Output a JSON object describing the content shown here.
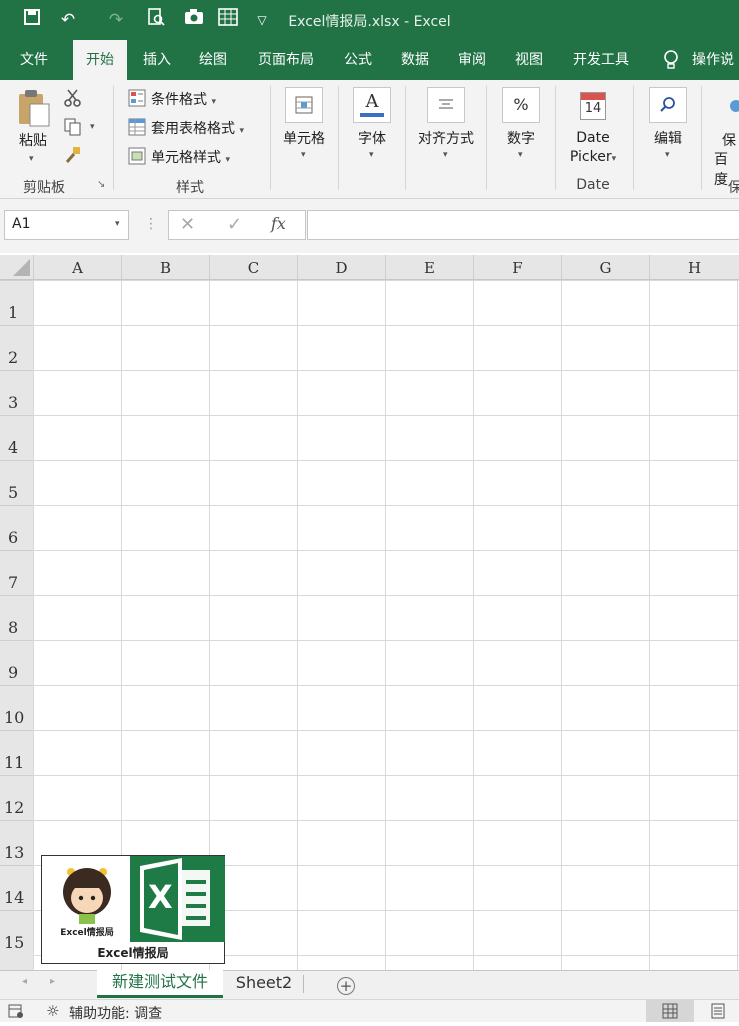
{
  "window": {
    "title": "Excel情报局.xlsx  -  Excel"
  },
  "ribbon_tabs": [
    "文件",
    "开始",
    "插入",
    "绘图",
    "页面布局",
    "公式",
    "数据",
    "审阅",
    "视图",
    "开发工具"
  ],
  "tell_me": "操作说",
  "clipboard": {
    "paste_label": "粘贴",
    "group_label": "剪贴板"
  },
  "styles": {
    "conditional": "条件格式",
    "table": "套用表格格式",
    "cell": "单元格样式",
    "group_label": "样式"
  },
  "cells_group": {
    "label": "单元格"
  },
  "font_group": {
    "label": "字体"
  },
  "align_group": {
    "label": "对齐方式"
  },
  "number_group": {
    "label": "数字",
    "glyph": "%"
  },
  "date_group": {
    "line1": "Date",
    "line2": "Picker",
    "group_label": "Date",
    "day": "14"
  },
  "edit_group": {
    "label": "编辑"
  },
  "extra_group": {
    "line1": "保",
    "line2": "百度",
    "group_label": "保"
  },
  "formula_bar": {
    "name_box": "A1",
    "fx": "fx",
    "value": ""
  },
  "columns": [
    "A",
    "B",
    "C",
    "D",
    "E",
    "F",
    "G",
    "H"
  ],
  "rows": [
    "1",
    "2",
    "3",
    "4",
    "5",
    "6",
    "7",
    "8",
    "9",
    "10",
    "11",
    "12",
    "13",
    "14",
    "15"
  ],
  "logo": {
    "badge_text": "Excel情报局",
    "caption": "Excel情报局",
    "x_letter": "X"
  },
  "sheets": [
    {
      "name": "新建测试文件",
      "active": true
    },
    {
      "name": "Sheet2",
      "active": false
    }
  ],
  "status": {
    "accessibility": "辅助功能: 调查"
  },
  "colors": {
    "brand": "#217346",
    "logo_green": "#1e7b45"
  }
}
